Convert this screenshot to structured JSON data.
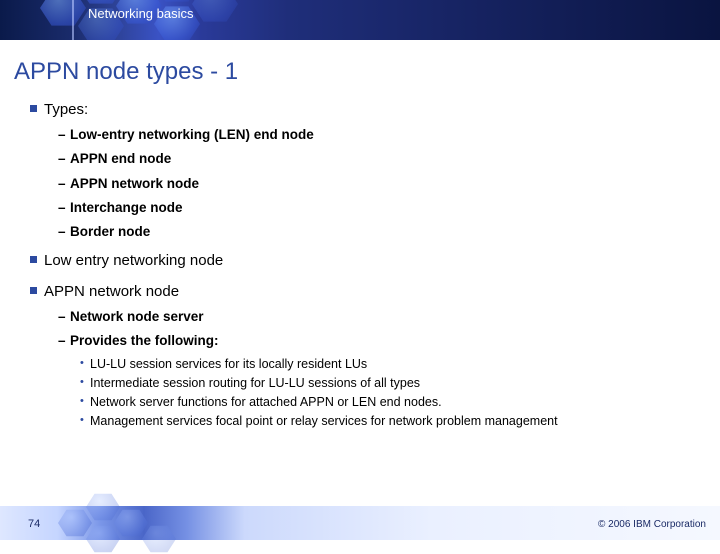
{
  "header": {
    "category": "Networking basics"
  },
  "title": "APPN node types - 1",
  "bullets": {
    "b1": "Types:",
    "b1_subs": {
      "s1": "Low-entry networking (LEN) end node",
      "s2": "APPN end node",
      "s3": "APPN network node",
      "s4": "Interchange node",
      "s5": "Border node"
    },
    "b2": "Low entry networking node",
    "b3": "APPN network node",
    "b3_subs": {
      "s1": "Network node server",
      "s2": "Provides the following:",
      "s2_items": {
        "i1": "LU-LU session services for its locally resident LUs",
        "i2": "Intermediate session routing for LU-LU sessions of all types",
        "i3": "Network server functions for attached APPN or LEN end nodes.",
        "i4": "Management services focal point or relay services for network problem management"
      }
    }
  },
  "footer": {
    "page": "74",
    "copyright": "© 2006 IBM Corporation"
  }
}
